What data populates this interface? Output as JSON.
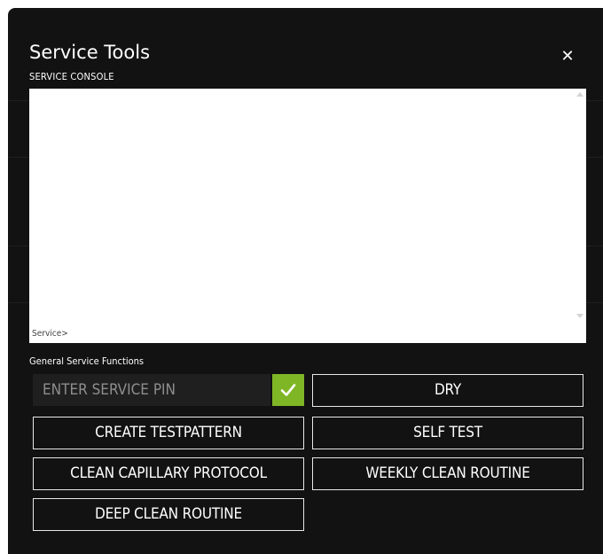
{
  "dialog": {
    "title": "Service Tools",
    "subtitle": "SERVICE CONSOLE",
    "close_glyph": "✕",
    "close_icon": "close-icon"
  },
  "console": {
    "prompt": "Service>",
    "content": ""
  },
  "general": {
    "label": "General Service Functions",
    "pin_placeholder": "ENTER SERVICE PIN",
    "pin_value": "",
    "confirm_icon": "checkmark-icon",
    "buttons": {
      "dry": "DRY",
      "create_testpattern": "CREATE TESTPATTERN",
      "self_test": "SELF TEST",
      "clean_capillary": "CLEAN CAPILLARY PROTOCOL",
      "weekly_clean": "WEEKLY CLEAN ROUTINE",
      "deep_clean": "DEEP CLEAN ROUTINE"
    }
  },
  "colors": {
    "modal_background": "#121212",
    "confirm_green": "#7fb626",
    "button_border": "#e8e8e8",
    "text": "#ffffff"
  }
}
